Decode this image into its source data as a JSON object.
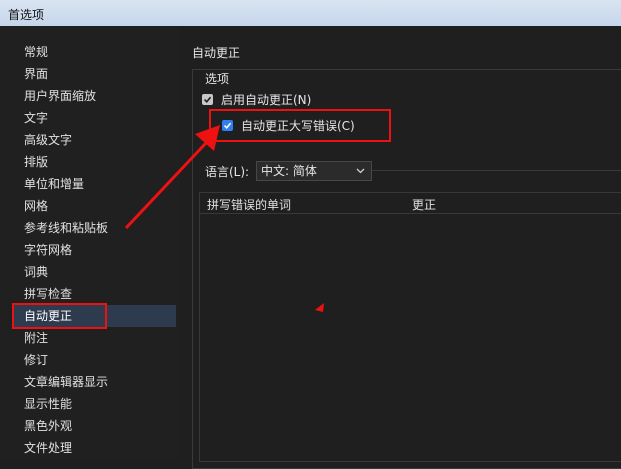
{
  "window": {
    "title": "首选项"
  },
  "sidebar": {
    "items": [
      {
        "label": "常规"
      },
      {
        "label": "界面"
      },
      {
        "label": "用户界面缩放"
      },
      {
        "label": "文字"
      },
      {
        "label": "高级文字"
      },
      {
        "label": "排版"
      },
      {
        "label": "单位和增量"
      },
      {
        "label": "网格"
      },
      {
        "label": "参考线和粘贴板"
      },
      {
        "label": "字符网格"
      },
      {
        "label": "词典"
      },
      {
        "label": "拼写检查"
      },
      {
        "label": "自动更正"
      },
      {
        "label": "附注"
      },
      {
        "label": "修订"
      },
      {
        "label": "文章编辑器显示"
      },
      {
        "label": "显示性能"
      },
      {
        "label": "黑色外观"
      },
      {
        "label": "文件处理"
      }
    ],
    "selected": "自动更正"
  },
  "panel": {
    "title": "自动更正",
    "options_legend": "选项",
    "enable_autocorrect": {
      "label": "启用自动更正(N)",
      "checked": true
    },
    "autocorrect_caps": {
      "label": "自动更正大写错误(C)",
      "checked": true
    },
    "language": {
      "label": "语言(L):",
      "value": "中文: 简体"
    },
    "table": {
      "columns": [
        "拼写错误的单词",
        "更正"
      ],
      "rows": []
    }
  },
  "colors": {
    "annotation": "#ee1111",
    "checkbox_blue": "#2f7ff2",
    "selected_item": "#2e3a4d"
  }
}
